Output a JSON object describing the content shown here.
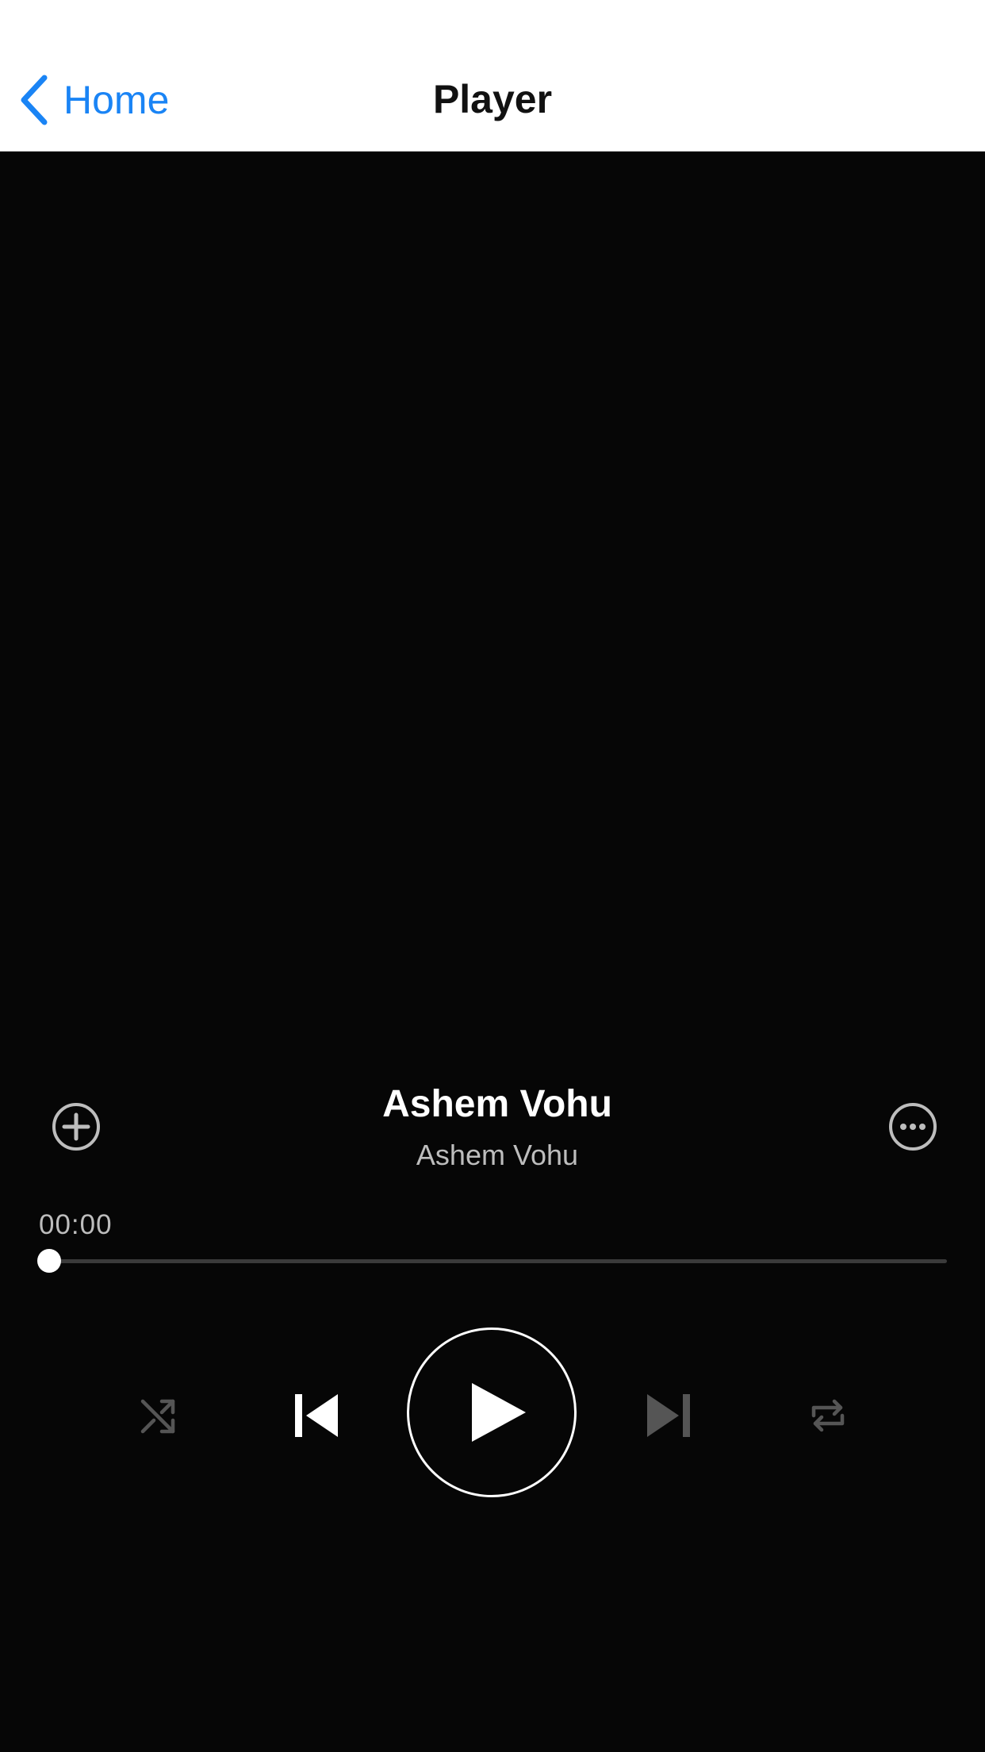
{
  "navbar": {
    "back_label": "Home",
    "title": "Player",
    "accent": "#1a84f5"
  },
  "track": {
    "title": "Ashem Vohu",
    "artist": "Ashem Vohu"
  },
  "playback": {
    "elapsed": "00:00",
    "progress": 0.0,
    "state": "paused"
  },
  "controls": {
    "add_icon": "plus-circle-icon",
    "more_icon": "ellipsis-circle-icon",
    "shuffle_icon": "shuffle-icon",
    "previous_icon": "skip-back-icon",
    "play_icon": "play-icon",
    "next_icon": "skip-forward-icon",
    "repeat_icon": "repeat-icon"
  },
  "colors": {
    "background": "#060606",
    "primary_text": "#ffffff",
    "secondary_text": "#bdbdbd",
    "disabled_icon": "#555555"
  }
}
